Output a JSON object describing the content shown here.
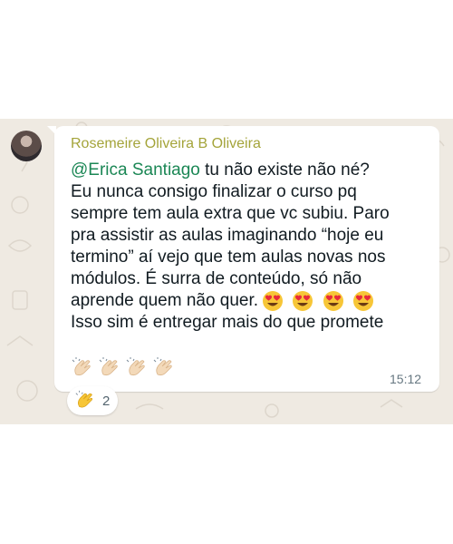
{
  "message": {
    "sender": "Rosemeire Oliveira B Oliveira",
    "mention": "@Erica Santiago",
    "lines": [
      " tu não existe não né?",
      "Eu nunca consigo finalizar o curso pq",
      "sempre tem aula extra que vc subiu. Paro",
      "pra assistir as aulas imaginando “hoje eu",
      "termino” aí vejo que tem aulas novas nos",
      "módulos. É surra de conteúdo, só não",
      "aprende quem não quer.",
      "Isso sim é entregar mais do que promete"
    ],
    "time": "15:12",
    "inline_emoji": [
      "smiling-face-heart-eyes",
      "smiling-face-heart-eyes",
      "smiling-face-heart-eyes",
      "smiling-face-heart-eyes"
    ],
    "clap_emoji": [
      "clapping-hands",
      "clapping-hands",
      "clapping-hands",
      "clapping-hands"
    ]
  },
  "reaction": {
    "emoji": "clapping-hands",
    "count": "2"
  },
  "colors": {
    "chat_background": "#efeae2",
    "sender_name": "#a4a43a",
    "mention": "#1b8755",
    "timestamp": "#667781"
  }
}
